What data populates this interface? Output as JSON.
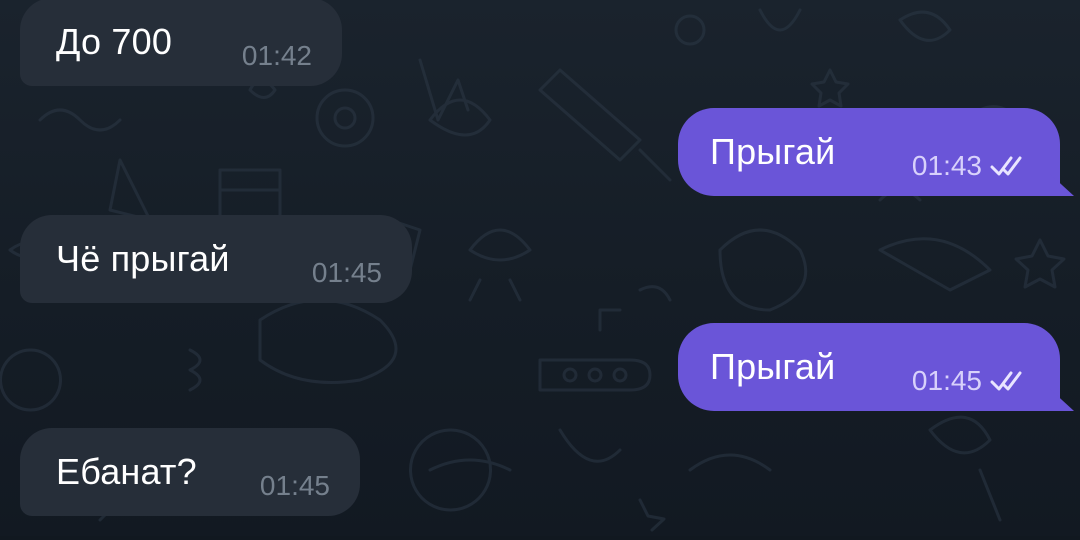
{
  "messages": [
    {
      "direction": "incoming",
      "text": "До 700",
      "time": "01:42"
    },
    {
      "direction": "outgoing",
      "text": "Прыгай",
      "time": "01:43",
      "status": "read"
    },
    {
      "direction": "incoming",
      "text": "Чё прыгай",
      "time": "01:45"
    },
    {
      "direction": "outgoing",
      "text": "Прыгай",
      "time": "01:45",
      "status": "read"
    },
    {
      "direction": "incoming",
      "text": "Ебанат?",
      "time": "01:45"
    }
  ],
  "icons": {
    "read_status": "double-check-icon"
  },
  "colors": {
    "background": "#18212b",
    "incoming_bubble": "#262e39",
    "outgoing_bubble": "#6a55d8",
    "incoming_time": "#75808d",
    "outgoing_time": "#d8d1fb",
    "text": "#ffffff"
  }
}
